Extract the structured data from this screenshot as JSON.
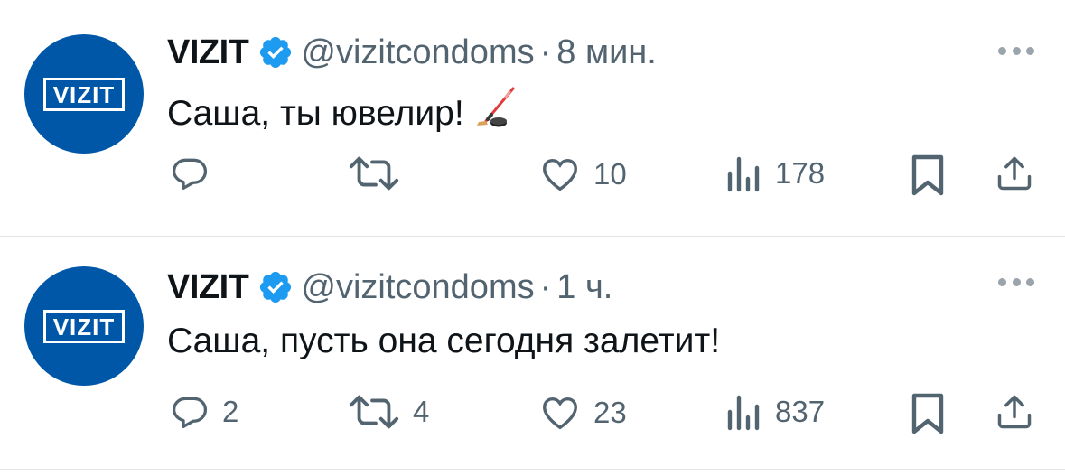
{
  "colors": {
    "accent": "#1d9bf0",
    "brand": "#0057a8",
    "muted": "#536471"
  },
  "tweets": [
    {
      "avatar_text": "VIZIT",
      "name": "VIZIT",
      "handle": "@vizitcondoms",
      "separator": "·",
      "time": "8 мин.",
      "text": "Саша, ты ювелир!",
      "emoji_icon": "ice-hockey-icon",
      "reply_count": "",
      "retweet_count": "",
      "like_count": "10",
      "view_count": "178"
    },
    {
      "avatar_text": "VIZIT",
      "name": "VIZIT",
      "handle": "@vizitcondoms",
      "separator": "·",
      "time": "1 ч.",
      "text": "Саша, пусть она сегодня залетит!",
      "reply_count": "2",
      "retweet_count": "4",
      "like_count": "23",
      "view_count": "837"
    }
  ]
}
